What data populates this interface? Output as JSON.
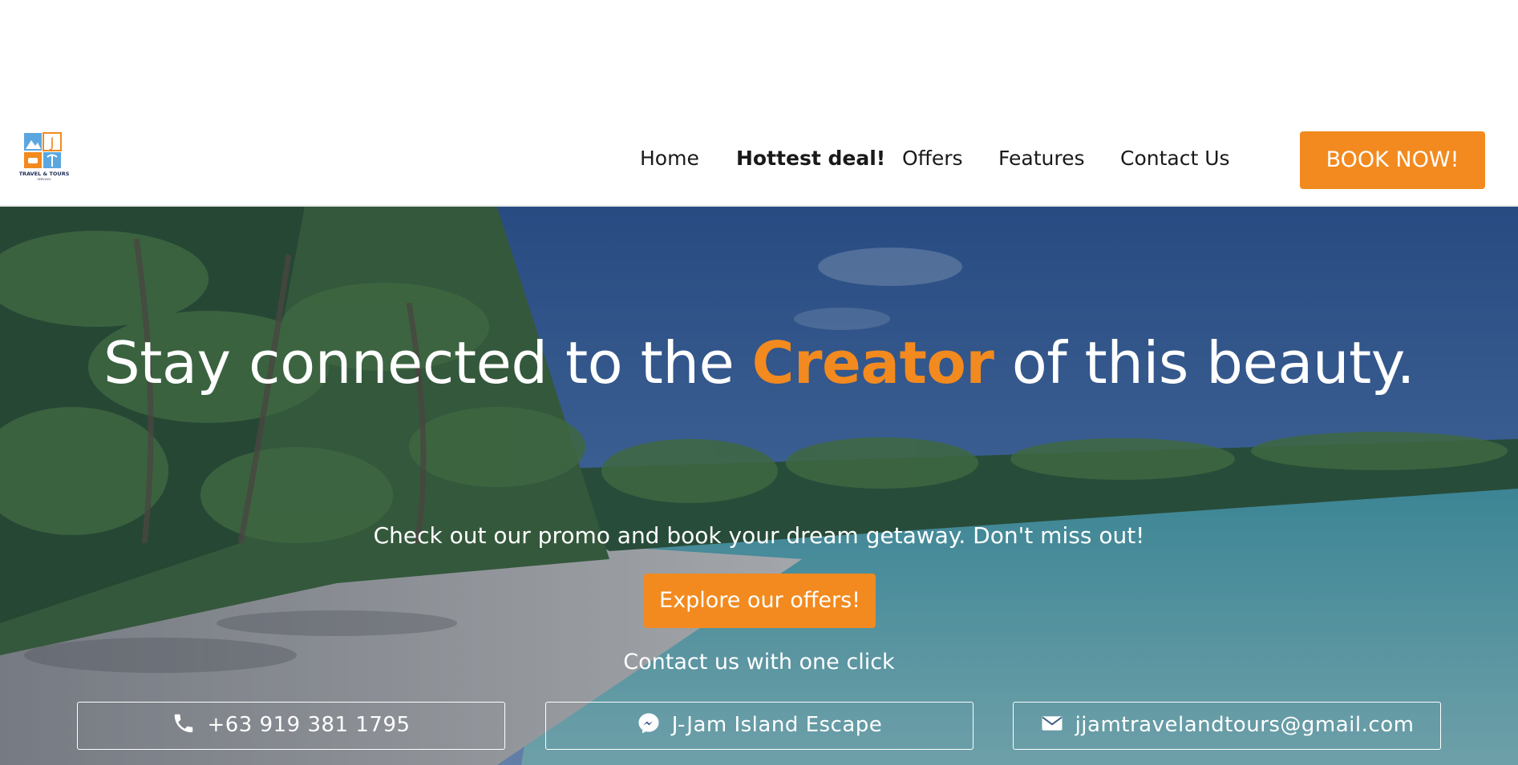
{
  "brand": {
    "logo_letter": "J",
    "logo_text": "TRAVEL & TOURS",
    "logo_subtext": "SERVICES"
  },
  "nav": {
    "items": [
      {
        "label": "Home"
      },
      {
        "label": "Hottest deal!"
      },
      {
        "label": "Offers"
      },
      {
        "label": "Features"
      },
      {
        "label": "Contact Us"
      }
    ],
    "active": "Hottest deal!",
    "cta_label": "BOOK NOW!"
  },
  "hero": {
    "headline_before": "Stay connected to the ",
    "headline_accent": "Creator",
    "headline_after": " of this beauty.",
    "subtext": "Check out our promo and book your dream getaway. Don't miss out!",
    "explore_label": "Explore our offers!",
    "contact_prompt": "Contact us with one click"
  },
  "contacts": [
    {
      "icon": "phone-icon",
      "label": "+63 919 381 1795"
    },
    {
      "icon": "messenger-icon",
      "label": "J-Jam Island Escape"
    },
    {
      "icon": "envelope-icon",
      "label": "jjamtravelandtours@gmail.com"
    }
  ],
  "colors": {
    "accent": "#f28a1f",
    "text_dark": "#1a1a1a",
    "white": "#ffffff"
  }
}
